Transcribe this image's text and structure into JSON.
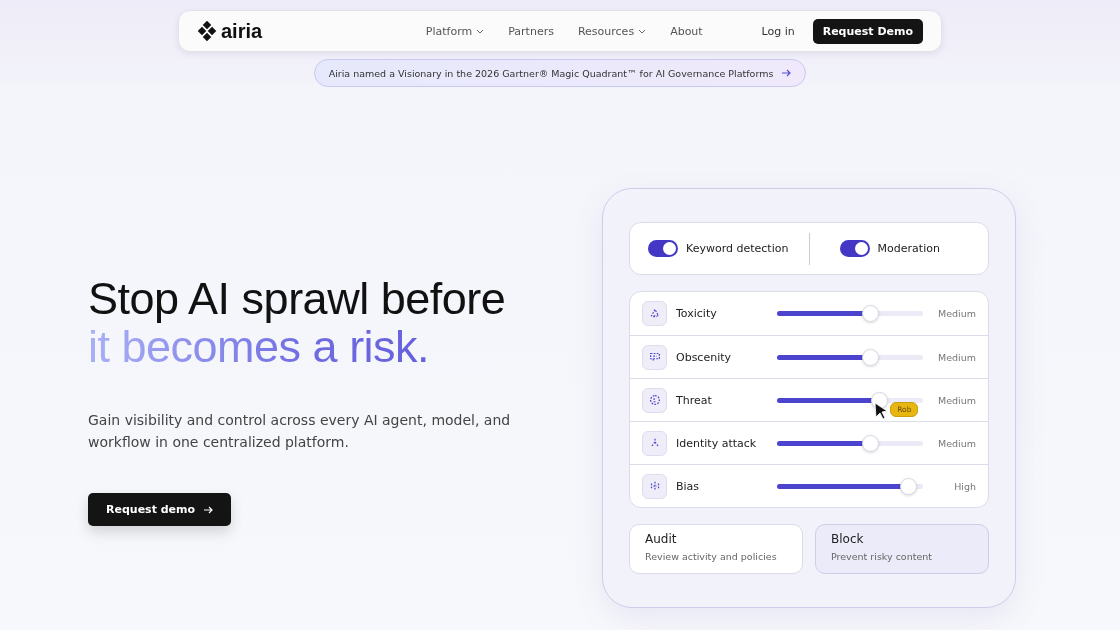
{
  "nav": {
    "logo": "airia",
    "links": [
      {
        "label": "Platform",
        "dropdown": true
      },
      {
        "label": "Partners",
        "dropdown": false
      },
      {
        "label": "Resources",
        "dropdown": true
      },
      {
        "label": "About",
        "dropdown": false
      }
    ],
    "login": "Log in",
    "cta": "Request Demo"
  },
  "banner": {
    "text": "Airia named a Visionary in the 2026 Gartner® Magic Quadrant™ for AI Governance Platforms"
  },
  "hero": {
    "title_line1": "Stop AI sprawl before",
    "title_line2": "it becomes a risk.",
    "subtitle": "Gain visibility and control across every AI agent, model, and workflow in one centralized platform.",
    "cta": "Request demo"
  },
  "panel": {
    "toggles": [
      {
        "label": "Keyword detection",
        "on": true
      },
      {
        "label": "Moderation",
        "on": true
      }
    ],
    "rows": [
      {
        "name": "Toxicity",
        "level": 0.64,
        "reading": "Medium"
      },
      {
        "name": "Obscenity",
        "level": 0.64,
        "reading": "Medium"
      },
      {
        "name": "Threat",
        "level": 0.7,
        "reading": "Medium",
        "cursor_label": "Rob"
      },
      {
        "name": "Identity attack",
        "level": 0.64,
        "reading": "Medium"
      },
      {
        "name": "Bias",
        "level": 0.9,
        "reading": "High"
      }
    ],
    "actions": [
      {
        "title": "Audit",
        "description": "Review activity and policies",
        "selected": false
      },
      {
        "title": "Block",
        "description": "Prevent risky content",
        "selected": true
      }
    ]
  }
}
